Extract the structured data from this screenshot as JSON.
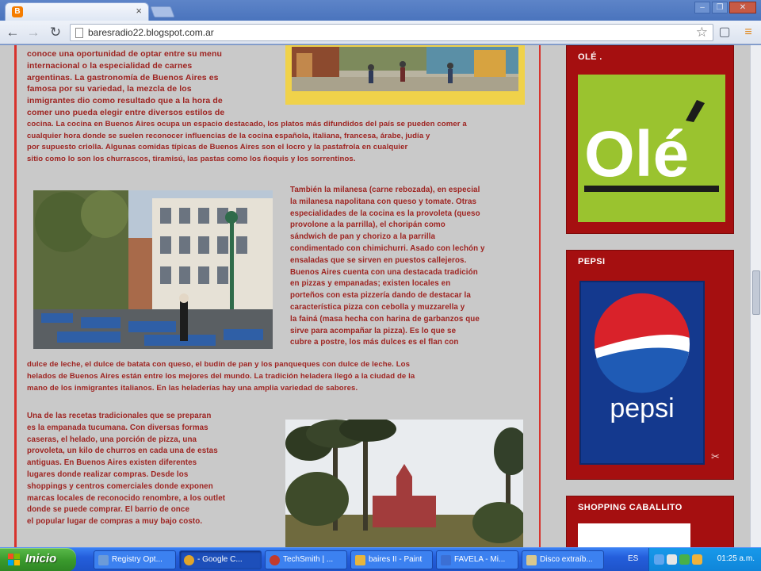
{
  "browser": {
    "tab_title": "",
    "url": "baresradio22.blogspot.com.ar",
    "tab_close": "×"
  },
  "post": {
    "para1_lines": [
      "conoce una oportunidad de optar entre su menu",
      "internacional o la especialidad de carnes",
      "argentinas. La gastronomía de Buenos Aires es",
      "famosa por su variedad, la mezcla de los",
      "inmigrantes dio como resultado que a la hora de",
      "comer uno pueda elegir entre diversos estilos de",
      "cocina. La cocina en Buenos Aires ocupa un espacio destacado, los platos más difundidos del país se pueden comer a",
      "cualquier hora donde se suelen reconocer influencias de la cocina española, italiana, francesa, árabe, judía y",
      "por supuesto criolla. Algunas comidas típicas de Buenos Aires son el locro y la pastafrola en cualquier",
      "sitio como lo son los churrascos, tiramisú, las pastas como los ñoquis y los sorrentinos."
    ],
    "para2_lines": [
      "También la milanesa (carne rebozada), en especial",
      "la milanesa napolitana con queso y tomate. Otras",
      "especialidades de la cocina es la provoleta (queso",
      "provolone a la parrilla), el choripán como",
      "sándwich de pan y chorizo a la parrilla",
      "condimentado con chimichurri. Asado con lechón y",
      "ensaladas que se sirven en puestos callejeros.",
      "Buenos Aires cuenta con una destacada tradición",
      "en pizzas y empanadas; existen locales en",
      "porteños con esta pizzería dando de destacar la",
      "característica pizza con cebolla y muzzarella y",
      "la fainá (masa hecha con harina de garbanzos que",
      "sirve para acompañar la pizza). Es lo que se",
      "cubre a postre, los más dulces es el flan con"
    ],
    "para3_lines": [
      "dulce de leche, el dulce de batata con queso, el budín de pan y los panqueques con dulce de leche. Los",
      "helados de Buenos Aires están entre los mejores del mundo. La tradición heladera llegó a la ciudad de la",
      "mano de los inmigrantes italianos. En las heladerías hay una amplia variedad de sabores."
    ],
    "para4_lines": [
      "Una de las recetas tradicionales que se preparan",
      "es la empanada tucumana. Con diversas formas",
      "caseras, el helado, una porción de pizza, una",
      "provoleta, un kilo de churros en cada una de estas",
      "antiguas. En Buenos Aires existen diferentes",
      "lugares donde realizar compras. Desde los",
      "shoppings y centros comerciales donde exponen",
      "marcas locales de reconocido renombre, a los outlet",
      "donde se puede comprar. El barrio de once",
      "el popular lugar de compras a muy bajo costo."
    ]
  },
  "sidebar": {
    "widgets": [
      {
        "title": "OLÉ ."
      },
      {
        "title": "PEPSI"
      },
      {
        "title": "SHOPPING CABALLITO"
      }
    ],
    "ole_logo_text": "Olé",
    "pepsi_logo_text": "pepsi"
  },
  "taskbar": {
    "start_label": "Inicio",
    "tasks": [
      {
        "label": "Registry Opt...",
        "icon_color": "#6c9bd8"
      },
      {
        "label": "- Google C...",
        "icon_color": "#e0a52a"
      },
      {
        "label": "TechSmith | ...",
        "icon_color": "#c23b2c"
      },
      {
        "label": "baires II - Paint",
        "icon_color": "#e7b53c"
      },
      {
        "label": "FAVELA - Mi...",
        "icon_color": "#3b6fd4"
      },
      {
        "label": "Disco extraíb...",
        "icon_color": "#d9c88e"
      }
    ],
    "lang": "ES",
    "clock": "01:25 a.m."
  },
  "colors": {
    "page_bg": "#c9c9c9",
    "text_red": "#9e2320",
    "widget_red": "#a50f10",
    "ole_green": "#9ac32f",
    "pepsi_blue": "#14398e"
  }
}
